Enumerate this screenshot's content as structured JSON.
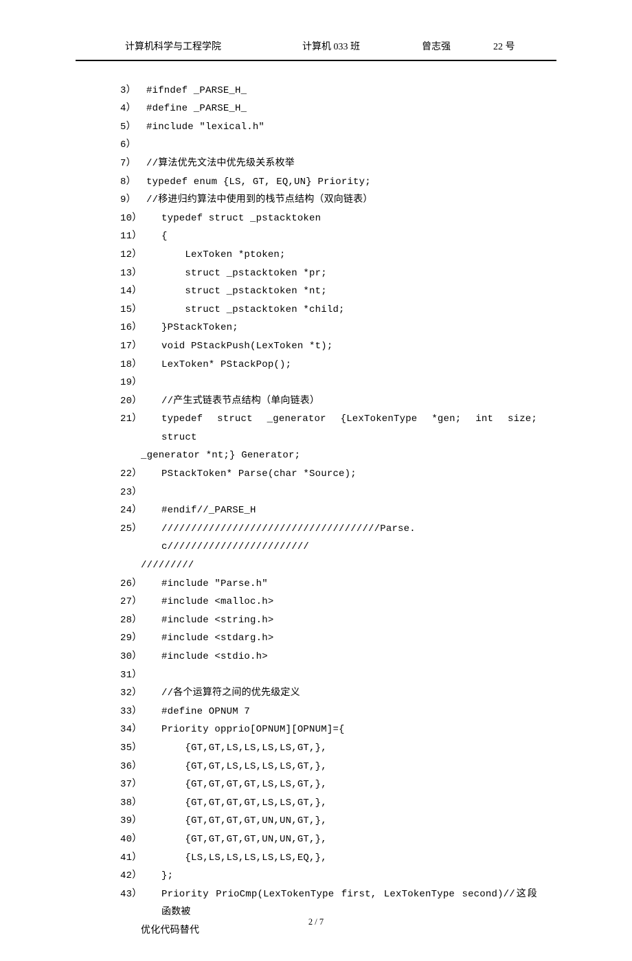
{
  "header": {
    "dept": "计算机科学与工程学院",
    "cls": "计算机 033 班",
    "name": "曾志强",
    "num": "22 号"
  },
  "lines": [
    {
      "n": "3）",
      "t": "#ifndef _PARSE_H_"
    },
    {
      "n": "4）",
      "t": "#define _PARSE_H_"
    },
    {
      "n": "5）",
      "t": "#include \"lexical.h\""
    },
    {
      "n": "6）",
      "t": ""
    },
    {
      "n": "7）",
      "t": "//算法优先文法中优先级关系枚举"
    },
    {
      "n": "8）",
      "t": "typedef enum {LS, GT, EQ,UN} Priority;"
    },
    {
      "n": "9）",
      "t": "//移进归约算法中使用到的栈节点结构（双向链表）"
    },
    {
      "n": "10）",
      "wide": true,
      "t": "typedef struct _pstacktoken"
    },
    {
      "n": "11）",
      "wide": true,
      "t": "{"
    },
    {
      "n": "12）",
      "wide": true,
      "t": "    LexToken *ptoken;"
    },
    {
      "n": "13）",
      "wide": true,
      "t": "    struct _pstacktoken *pr;"
    },
    {
      "n": "14）",
      "wide": true,
      "t": "    struct _pstacktoken *nt;"
    },
    {
      "n": "15）",
      "wide": true,
      "t": "    struct _pstacktoken *child;"
    },
    {
      "n": "16）",
      "wide": true,
      "t": "}PStackToken;"
    },
    {
      "n": "17）",
      "wide": true,
      "t": "void PStackPush(LexToken *t);"
    },
    {
      "n": "18）",
      "wide": true,
      "t": "LexToken* PStackPop();"
    },
    {
      "n": "19）",
      "wide": true,
      "t": ""
    },
    {
      "n": "20）",
      "wide": true,
      "t": "//产生式链表节点结构（单向链表）"
    },
    {
      "n": "21）",
      "wide": true,
      "t": "typedef  struct  _generator  {LexTokenType  *gen;  int  size;  struct",
      "cont": "_generator *nt;} Generator;"
    },
    {
      "n": "22）",
      "wide": true,
      "t": "PStackToken* Parse(char *Source);"
    },
    {
      "n": "23）",
      "wide": true,
      "t": ""
    },
    {
      "n": "24）",
      "wide": true,
      "t": "#endif//_PARSE_H"
    },
    {
      "n": "25）",
      "wide": true,
      "t": "/////////////////////////////////////Parse.c////////////////////////",
      "cont": "/////////"
    },
    {
      "n": "26）",
      "wide": true,
      "t": "#include \"Parse.h\""
    },
    {
      "n": "27）",
      "wide": true,
      "t": "#include <malloc.h>"
    },
    {
      "n": "28）",
      "wide": true,
      "t": "#include <string.h>"
    },
    {
      "n": "29）",
      "wide": true,
      "t": "#include <stdarg.h>"
    },
    {
      "n": "30）",
      "wide": true,
      "t": "#include <stdio.h>"
    },
    {
      "n": "31）",
      "wide": true,
      "t": ""
    },
    {
      "n": "32）",
      "wide": true,
      "t": "//各个运算符之间的优先级定义"
    },
    {
      "n": "33）",
      "wide": true,
      "t": "#define OPNUM 7"
    },
    {
      "n": "34）",
      "wide": true,
      "t": "Priority opprio[OPNUM][OPNUM]={"
    },
    {
      "n": "35）",
      "wide": true,
      "t": "    {GT,GT,LS,LS,LS,LS,GT,},"
    },
    {
      "n": "36）",
      "wide": true,
      "t": "    {GT,GT,LS,LS,LS,LS,GT,},"
    },
    {
      "n": "37）",
      "wide": true,
      "t": "    {GT,GT,GT,GT,LS,LS,GT,},"
    },
    {
      "n": "38）",
      "wide": true,
      "t": "    {GT,GT,GT,GT,LS,LS,GT,},"
    },
    {
      "n": "39）",
      "wide": true,
      "t": "    {GT,GT,GT,GT,UN,UN,GT,},"
    },
    {
      "n": "40）",
      "wide": true,
      "t": "    {GT,GT,GT,GT,UN,UN,GT,},"
    },
    {
      "n": "41）",
      "wide": true,
      "t": "    {LS,LS,LS,LS,LS,LS,EQ,},"
    },
    {
      "n": "42）",
      "wide": true,
      "t": "};"
    },
    {
      "n": "43）",
      "wide": true,
      "t": "Priority PrioCmp(LexTokenType first, LexTokenType second)//这段函数被",
      "cont": "优化代码替代"
    }
  ],
  "footer": "2 / 7"
}
